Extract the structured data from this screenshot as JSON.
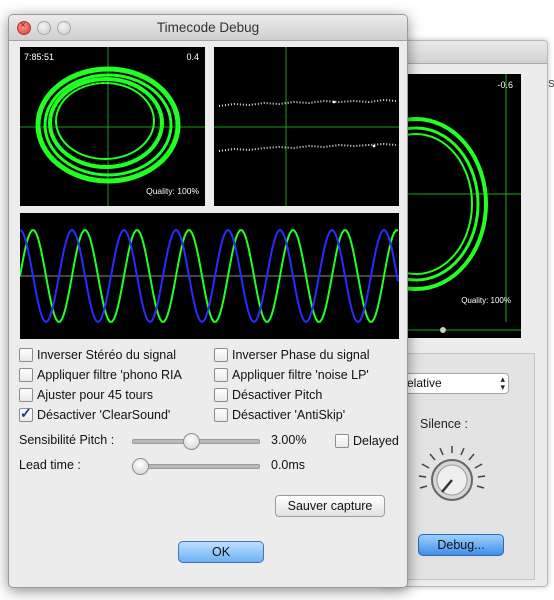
{
  "background_window": {
    "scope_value": "-0.6",
    "scope_quality": "Quality: 100%",
    "mode_select_value": "relative",
    "silence_label": "Silence :",
    "debug_button_label": "Debug...",
    "edge_letter": "S"
  },
  "window": {
    "title": "Timecode Debug"
  },
  "scopes": {
    "scope1_time": "7:85:51",
    "scope1_value": "0.4",
    "scope1_quality": "Quality: 100%"
  },
  "options": [
    {
      "label": "Inverser Stéréo du signal",
      "checked": false
    },
    {
      "label": "Inverser Phase du signal",
      "checked": false
    },
    {
      "label": "Appliquer filtre 'phono RIA",
      "checked": false
    },
    {
      "label": "Appliquer filtre 'noise LP'",
      "checked": false
    },
    {
      "label": "Ajuster pour 45 tours",
      "checked": false
    },
    {
      "label": "Désactiver Pitch",
      "checked": false
    },
    {
      "label": "Désactiver 'ClearSound'",
      "checked": true
    },
    {
      "label": "Désactiver 'AntiSkip'",
      "checked": false
    }
  ],
  "pitch": {
    "label": "Sensibilité Pitch :",
    "value": "3.00%",
    "slider_fraction": 0.45,
    "delayed_label": "Delayed",
    "delayed_checked": false
  },
  "lead_time": {
    "label": "Lead time :",
    "value": "0.0ms",
    "slider_fraction": 0.0
  },
  "buttons": {
    "save_label": "Sauver capture",
    "ok_label": "OK"
  },
  "colors": {
    "signal_green": "#22ff22",
    "signal_blue": "#2b2bff",
    "ok_accent": "#6eb0f5"
  }
}
